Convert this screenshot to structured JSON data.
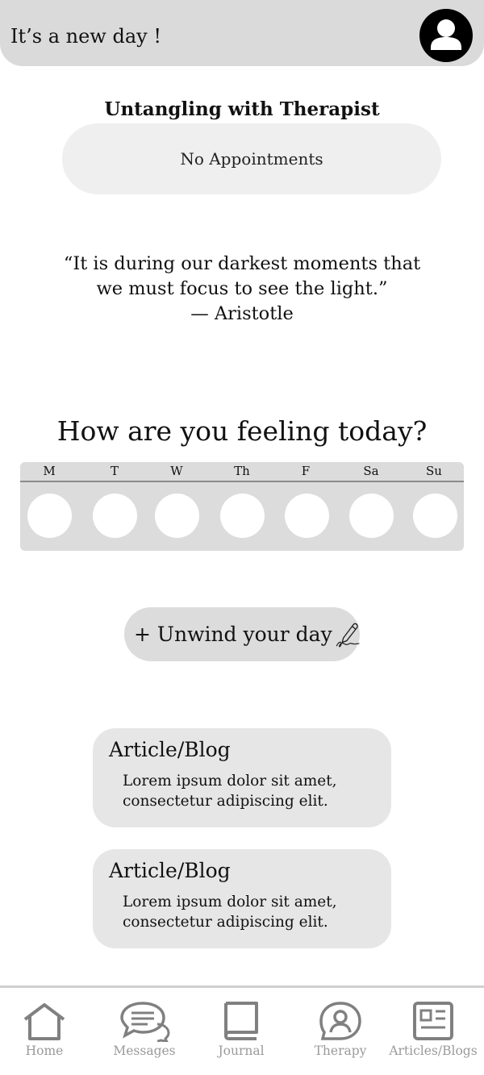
{
  "header": {
    "greeting": "It’s a new day !",
    "avatar_icon": "user-avatar-icon"
  },
  "therapist": {
    "title": "Untangling with Therapist",
    "appointments": "No Appointments"
  },
  "quote": {
    "line1": "“It is during our darkest moments that",
    "line2": "we must focus to see the light.”",
    "author": "— Aristotle"
  },
  "mood": {
    "heading": "How are you feeling today?",
    "days": [
      "M",
      "T",
      "W",
      "Th",
      "F",
      "Sa",
      "Su"
    ]
  },
  "unwind": {
    "label": "+ Unwind your day",
    "icon": "pen-icon"
  },
  "articles": [
    {
      "title": "Article/Blog",
      "line1": "Lorem ipsum dolor sit amet,",
      "line2": "consectetur adipiscing elit."
    },
    {
      "title": "Article/Blog",
      "line1": "Lorem ipsum dolor sit amet,",
      "line2": "consectetur adipiscing elit."
    }
  ],
  "nav": [
    {
      "label": "Home",
      "icon": "home-icon"
    },
    {
      "label": "Messages",
      "icon": "messages-icon"
    },
    {
      "label": "Journal",
      "icon": "journal-icon"
    },
    {
      "label": "Therapy",
      "icon": "therapy-icon"
    },
    {
      "label": "Articles/Blogs",
      "icon": "articles-icon"
    }
  ],
  "colors": {
    "header_bg": "#dadada",
    "panel_bg": "#dcdcdc",
    "nav_text": "#9a9a9a"
  }
}
